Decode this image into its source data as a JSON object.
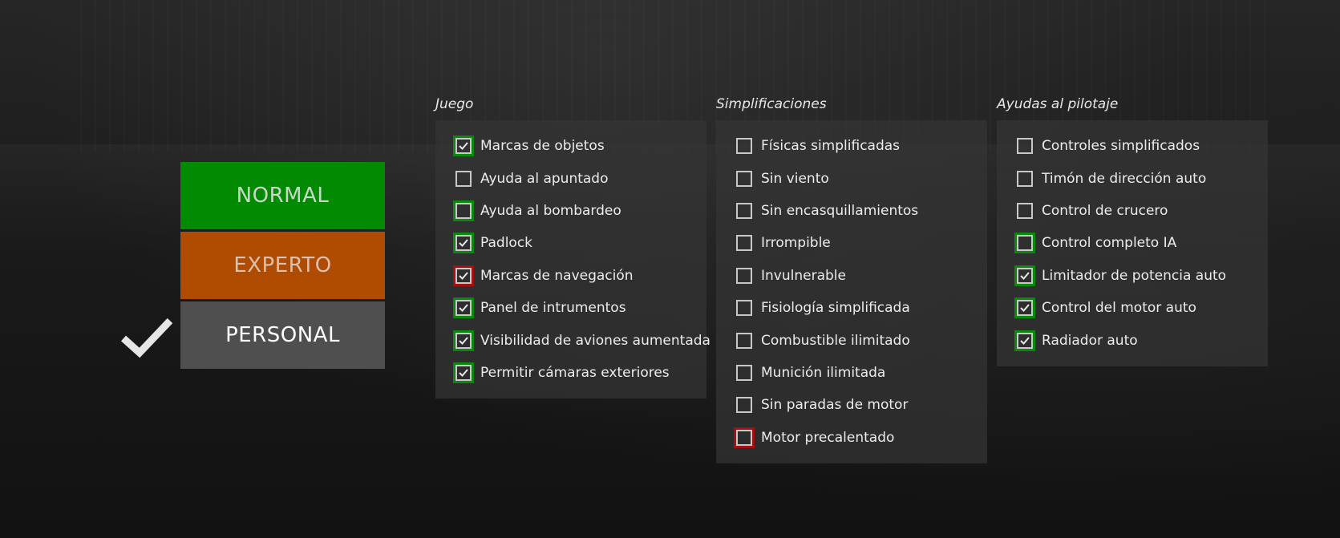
{
  "presets": {
    "normal": "NORMAL",
    "experto": "EXPERTO",
    "personal": "PERSONAL",
    "selected": "personal",
    "colors": {
      "normal": "#038a03",
      "experto": "#b04c02",
      "personal": "#4f4f4f"
    }
  },
  "juego": {
    "title": "Juego",
    "items": [
      {
        "label": "Marcas de objetos",
        "checked": true,
        "frame": "green"
      },
      {
        "label": "Ayuda al apuntado",
        "checked": false,
        "frame": "none"
      },
      {
        "label": "Ayuda al bombardeo",
        "checked": false,
        "frame": "green"
      },
      {
        "label": "Padlock",
        "checked": true,
        "frame": "green"
      },
      {
        "label": "Marcas de navegación",
        "checked": true,
        "frame": "red"
      },
      {
        "label": "Panel de intrumentos",
        "checked": true,
        "frame": "green"
      },
      {
        "label": "Visibilidad de aviones aumentada",
        "checked": true,
        "frame": "green"
      },
      {
        "label": "Permitir cámaras exteriores",
        "checked": true,
        "frame": "green"
      }
    ]
  },
  "simplificaciones": {
    "title": "Simplificaciones",
    "items": [
      {
        "label": "Físicas simplificadas",
        "checked": false,
        "frame": "none"
      },
      {
        "label": "Sin viento",
        "checked": false,
        "frame": "none"
      },
      {
        "label": "Sin encasquillamientos",
        "checked": false,
        "frame": "none"
      },
      {
        "label": "Irrompible",
        "checked": false,
        "frame": "none"
      },
      {
        "label": "Invulnerable",
        "checked": false,
        "frame": "none"
      },
      {
        "label": "Fisiología simplificada",
        "checked": false,
        "frame": "none"
      },
      {
        "label": "Combustible ilimitado",
        "checked": false,
        "frame": "none"
      },
      {
        "label": "Munición ilimitada",
        "checked": false,
        "frame": "none"
      },
      {
        "label": "Sin paradas de motor",
        "checked": false,
        "frame": "none"
      },
      {
        "label": "Motor precalentado",
        "checked": false,
        "frame": "red"
      }
    ]
  },
  "ayudas": {
    "title": "Ayudas al pilotaje",
    "items": [
      {
        "label": "Controles simplificados",
        "checked": false,
        "frame": "none"
      },
      {
        "label": "Timón de dirección auto",
        "checked": false,
        "frame": "none"
      },
      {
        "label": "Control de crucero",
        "checked": false,
        "frame": "none"
      },
      {
        "label": "Control completo IA",
        "checked": false,
        "frame": "green"
      },
      {
        "label": "Limitador de potencia auto",
        "checked": true,
        "frame": "green"
      },
      {
        "label": "Control del motor auto",
        "checked": true,
        "frame": "green"
      },
      {
        "label": "Radiador auto",
        "checked": true,
        "frame": "green"
      }
    ]
  }
}
